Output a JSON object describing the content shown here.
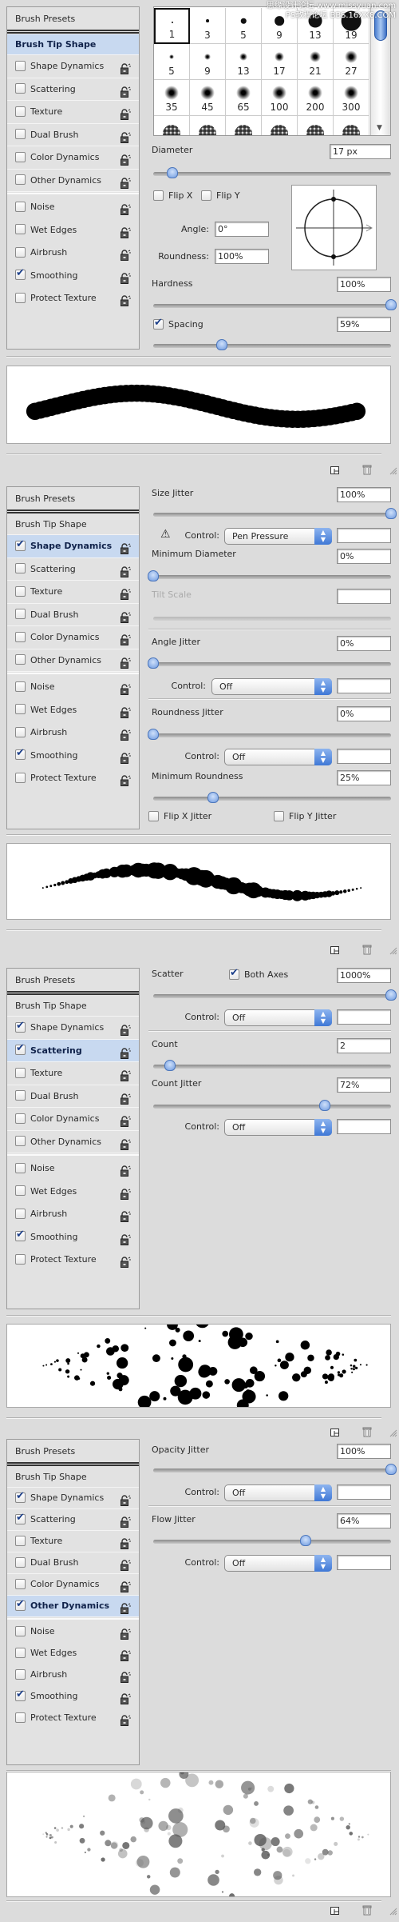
{
  "watermark": [
    "思缘设计论坛 www.missyuan.com",
    "PS教程论坛 BBS.16XX8.COM"
  ],
  "accent_color": "#c8d9f0",
  "footer_icons": [
    "new-brush-icon",
    "trash-icon",
    "resize-grip-icon"
  ],
  "panels": [
    {
      "sidebar": {
        "header": "Brush Presets",
        "tip": "Brush Tip Shape",
        "selected": "tip",
        "group1": [
          {
            "label": "Shape Dynamics",
            "checked": false
          },
          {
            "label": "Scattering",
            "checked": false
          },
          {
            "label": "Texture",
            "checked": false
          },
          {
            "label": "Dual Brush",
            "checked": false
          },
          {
            "label": "Color Dynamics",
            "checked": false
          },
          {
            "label": "Other Dynamics",
            "checked": false
          }
        ],
        "group2": [
          {
            "label": "Noise",
            "checked": false
          },
          {
            "label": "Wet Edges",
            "checked": false
          },
          {
            "label": "Airbrush",
            "checked": false
          },
          {
            "label": "Smoothing",
            "checked": true
          },
          {
            "label": "Protect Texture",
            "checked": false
          }
        ]
      },
      "brush_grid": {
        "rows": [
          [
            "1",
            "3",
            "5",
            "9",
            "13",
            "19"
          ],
          [
            "5",
            "9",
            "13",
            "17",
            "21",
            "27"
          ],
          [
            "35",
            "45",
            "65",
            "100",
            "200",
            "300"
          ],
          [
            "",
            "",
            "",
            "",
            "",
            ""
          ]
        ],
        "selected_index": 0
      },
      "diameter": {
        "label": "Diameter",
        "value": "17 px",
        "slider": 0.08
      },
      "flip_x": {
        "label": "Flip X",
        "checked": false
      },
      "flip_y": {
        "label": "Flip Y",
        "checked": false
      },
      "angle": {
        "label": "Angle:",
        "value": "0°"
      },
      "roundness": {
        "label": "Roundness:",
        "value": "100%"
      },
      "hardness": {
        "label": "Hardness",
        "value": "100%",
        "slider": 1.0
      },
      "spacing": {
        "label": "Spacing",
        "value": "59%",
        "checked": true,
        "slider": 0.29
      }
    },
    {
      "sidebar": {
        "header": "Brush Presets",
        "tip": "Brush Tip Shape",
        "selected": "Shape Dynamics",
        "group1": [
          {
            "label": "Shape Dynamics",
            "checked": true
          },
          {
            "label": "Scattering",
            "checked": false
          },
          {
            "label": "Texture",
            "checked": false
          },
          {
            "label": "Dual Brush",
            "checked": false
          },
          {
            "label": "Color Dynamics",
            "checked": false
          },
          {
            "label": "Other Dynamics",
            "checked": false
          }
        ],
        "group2": [
          {
            "label": "Noise",
            "checked": false
          },
          {
            "label": "Wet Edges",
            "checked": false
          },
          {
            "label": "Airbrush",
            "checked": false
          },
          {
            "label": "Smoothing",
            "checked": true
          },
          {
            "label": "Protect Texture",
            "checked": false
          }
        ]
      },
      "size_jitter": {
        "label": "Size Jitter",
        "value": "100%",
        "slider": 1.0
      },
      "size_control": {
        "label": "Control:",
        "value": "Pen Pressure",
        "warning": true
      },
      "min_diameter": {
        "label": "Minimum Diameter",
        "value": "0%",
        "slider": 0.0
      },
      "tilt_scale": {
        "label": "Tilt Scale",
        "value": "",
        "disabled": true
      },
      "angle_jitter": {
        "label": "Angle Jitter",
        "value": "0%",
        "slider": 0.0
      },
      "angle_control": {
        "label": "Control:",
        "value": "Off"
      },
      "roundness_jitter": {
        "label": "Roundness Jitter",
        "value": "0%",
        "slider": 0.0
      },
      "roundness_control": {
        "label": "Control:",
        "value": "Off"
      },
      "min_roundness": {
        "label": "Minimum Roundness",
        "value": "25%",
        "slider": 0.25
      },
      "flip_x_jitter": {
        "label": "Flip X Jitter",
        "checked": false
      },
      "flip_y_jitter": {
        "label": "Flip Y Jitter",
        "checked": false
      }
    },
    {
      "sidebar": {
        "header": "Brush Presets",
        "tip": "Brush Tip Shape",
        "selected": "Scattering",
        "group1": [
          {
            "label": "Shape Dynamics",
            "checked": true
          },
          {
            "label": "Scattering",
            "checked": true
          },
          {
            "label": "Texture",
            "checked": false
          },
          {
            "label": "Dual Brush",
            "checked": false
          },
          {
            "label": "Color Dynamics",
            "checked": false
          },
          {
            "label": "Other Dynamics",
            "checked": false
          }
        ],
        "group2": [
          {
            "label": "Noise",
            "checked": false
          },
          {
            "label": "Wet Edges",
            "checked": false
          },
          {
            "label": "Airbrush",
            "checked": false
          },
          {
            "label": "Smoothing",
            "checked": true
          },
          {
            "label": "Protect Texture",
            "checked": false
          }
        ]
      },
      "scatter": {
        "label": "Scatter",
        "value": "1000%",
        "slider": 1.0
      },
      "both_axes": {
        "label": "Both Axes",
        "checked": true
      },
      "scatter_control": {
        "label": "Control:",
        "value": "Off"
      },
      "count": {
        "label": "Count",
        "value": "2",
        "slider": 0.07
      },
      "count_jitter": {
        "label": "Count Jitter",
        "value": "72%",
        "slider": 0.72
      },
      "count_control": {
        "label": "Control:",
        "value": "Off"
      }
    },
    {
      "sidebar": {
        "header": "Brush Presets",
        "tip": "Brush Tip Shape",
        "selected": "Other Dynamics",
        "group1": [
          {
            "label": "Shape Dynamics",
            "checked": true
          },
          {
            "label": "Scattering",
            "checked": true
          },
          {
            "label": "Texture",
            "checked": false
          },
          {
            "label": "Dual Brush",
            "checked": false
          },
          {
            "label": "Color Dynamics",
            "checked": false
          },
          {
            "label": "Other Dynamics",
            "checked": true
          }
        ],
        "group2": [
          {
            "label": "Noise",
            "checked": false
          },
          {
            "label": "Wet Edges",
            "checked": false
          },
          {
            "label": "Airbrush",
            "checked": false
          },
          {
            "label": "Smoothing",
            "checked": true
          },
          {
            "label": "Protect Texture",
            "checked": false
          }
        ]
      },
      "opacity_jitter": {
        "label": "Opacity Jitter",
        "value": "100%",
        "slider": 1.0
      },
      "opacity_control": {
        "label": "Control:",
        "value": "Off"
      },
      "flow_jitter": {
        "label": "Flow Jitter",
        "value": "64%",
        "slider": 0.64
      },
      "flow_control": {
        "label": "Control:",
        "value": "Off"
      }
    }
  ]
}
